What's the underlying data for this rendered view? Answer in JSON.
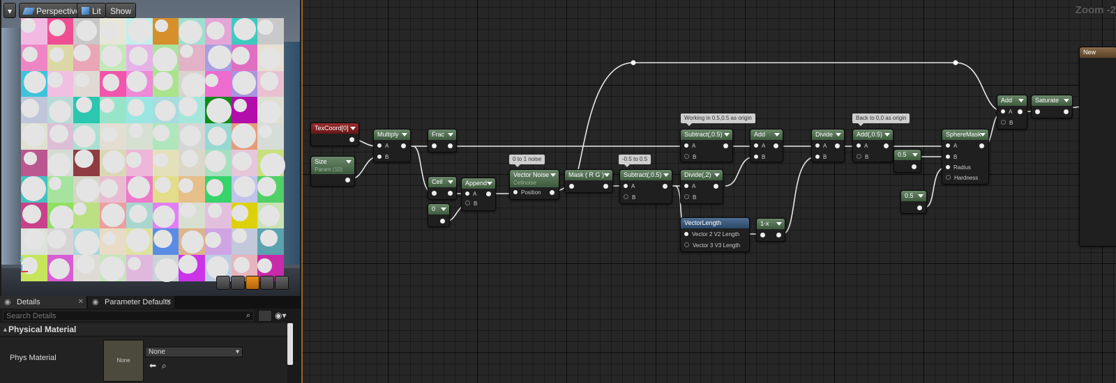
{
  "viewport": {
    "buttons": {
      "perspective": "Perspective",
      "lit": "Lit",
      "show": "Show"
    },
    "axis_label": "Z",
    "swatches": [
      [
        "#f2b9e3",
        "#ef4f92",
        "#c7c7c7",
        "#e8e6d8",
        "#bff0ec",
        "#d68f2a",
        "#9ee0cf",
        "#e3a6d7",
        "#3dcabf",
        "#c9c9c9"
      ],
      [
        "#ee86c5",
        "#dcd8a6",
        "#eaa6b7",
        "#c6e8b9",
        "#e6b3e9",
        "#a9e59b",
        "#e2b3c6",
        "#a99ee1",
        "#e06fc2",
        "#e6e0d2"
      ],
      [
        "#3ec4da",
        "#f0bfe1",
        "#dfd9d4",
        "#f155ac",
        "#ee8ad8",
        "#a9e48c",
        "#d9d4d0",
        "#ee6bd0",
        "#a994e1",
        "#e9c1d1"
      ],
      [
        "#c0c6d9",
        "#b8dbd8",
        "#2bc7af",
        "#96e5c8",
        "#9be6e3",
        "#a9dbdf",
        "#a5e6da",
        "#138a1a",
        "#b30dab",
        "#dedfd2"
      ],
      [
        "#dfe1cf",
        "#dcbfd7",
        "#aae0d2",
        "#e4ddd3",
        "#d6e0d2",
        "#b0e6bc",
        "#d4d7d6",
        "#97d9d2",
        "#e69b7b",
        "#d6dcd6"
      ],
      [
        "#bb5790",
        "#d5dcd2",
        "#8e3c41",
        "#d9d8b4",
        "#eeb6d9",
        "#e4e1ba",
        "#dbd7c9",
        "#a5e0bf",
        "#e5c7d9",
        "#c8e07e"
      ],
      [
        "#43c2c0",
        "#a6e39e",
        "#d6d6c6",
        "#e9bcd1",
        "#ee7acb",
        "#e3dd8a",
        "#e6bf8a",
        "#37d36b",
        "#c0c4ec",
        "#50d066"
      ],
      [
        "#c9418a",
        "#91df62",
        "#bbe083",
        "#ee9e9e",
        "#a9d7d0",
        "#e37ff5",
        "#d7e0d0",
        "#e4bfdd",
        "#ddd10a",
        "#c9e2b6"
      ],
      [
        "#dde2da",
        "#d7d4d6",
        "#aad9e0",
        "#e8dcc6",
        "#dee29f",
        "#5a8ce6",
        "#ddb58c",
        "#cfa4e3",
        "#c3c8da",
        "#5aa3ae"
      ],
      [
        "#c6e55a",
        "#d85cd3",
        "#dedbd5",
        "#c8e4bb",
        "#e0b8df",
        "#c9d4d8",
        "#cc34e9",
        "#bdcde4",
        "#e8b4bc",
        "#c72baa"
      ]
    ]
  },
  "details": {
    "tabs": [
      {
        "label": "Details"
      },
      {
        "label": "Parameter Defaults"
      }
    ],
    "search_placeholder": "Search Details",
    "section_title": "Physical Material",
    "property_label": "Phys Material",
    "thumbnail_label": "None",
    "dropdown_value": "None"
  },
  "graph": {
    "zoom": "Zoom -2",
    "partial_node_title": "New",
    "comments": [
      "0 to 1 noise",
      "-0.5 to 0.5",
      "Working in 0.5,0.5 as origin",
      "Back to 0,0 as origin"
    ],
    "nodes": {
      "texcoord": {
        "title": "TexCoord[0]"
      },
      "size": {
        "title": "Size",
        "subtitle": "Param (10)"
      },
      "multiply": {
        "title": "Multiply",
        "pins": [
          "A",
          "B"
        ]
      },
      "frac": {
        "title": "Frac"
      },
      "ceil": {
        "title": "Ceil"
      },
      "zero": {
        "title": "0"
      },
      "append": {
        "title": "Append",
        "pins": [
          "A",
          "B"
        ]
      },
      "vnoise": {
        "title": "Vector Noise",
        "subtitle": "Cellnoise",
        "pins": [
          "Position"
        ]
      },
      "mask": {
        "title": "Mask ( R G )"
      },
      "sub1": {
        "title": "Subtract(,0.5)",
        "pins": [
          "A",
          "B"
        ]
      },
      "sub2": {
        "title": "Subtract(,0.5)",
        "pins": [
          "A",
          "B"
        ]
      },
      "divide2": {
        "title": "Divide(,2)",
        "pins": [
          "A",
          "B"
        ]
      },
      "add1": {
        "title": "Add",
        "pins": [
          "A",
          "B"
        ]
      },
      "vlen": {
        "title": "VectorLength",
        "pins": [
          "Vector 2 V2 Length",
          "Vector 3 V3 Length"
        ]
      },
      "oneminus": {
        "title": "1-x"
      },
      "divide": {
        "title": "Divide",
        "pins": [
          "A",
          "B"
        ]
      },
      "add05": {
        "title": "Add(,0.5)",
        "pins": [
          "A",
          "B"
        ]
      },
      "c05a": {
        "title": "0.5"
      },
      "c05b": {
        "title": "0.5"
      },
      "sphere": {
        "title": "SphereMask",
        "pins": [
          "A",
          "B",
          "Radius",
          "Hardness"
        ]
      },
      "add2": {
        "title": "Add",
        "pins": [
          "A",
          "B"
        ]
      },
      "saturate": {
        "title": "Saturate"
      }
    }
  },
  "colors": {
    "input_node": "#7a2020",
    "param_node": "#3d5a3d",
    "function_node": "#2b4766",
    "accent": "#e8901d"
  }
}
